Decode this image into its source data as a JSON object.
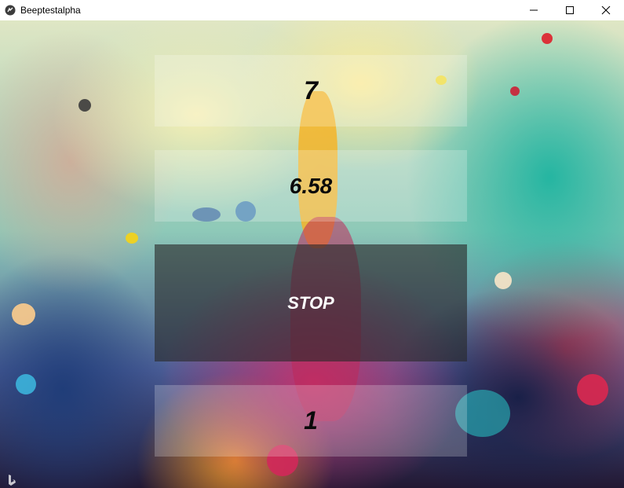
{
  "window": {
    "title": "Beeptestalpha",
    "icon": "kivy-logo-icon",
    "controls": [
      "minimize-icon",
      "maximize-icon",
      "close-icon"
    ]
  },
  "display": {
    "level": "7",
    "speed": "6.58",
    "button_label": "STOP",
    "shuttle": "1"
  },
  "colors": {
    "panel_light": "#ffffff",
    "panel_dark": "#282828",
    "text_dark": "#0a0a0a",
    "text_light": "#ffffff"
  },
  "watermark": {
    "icon": "bing-logo-icon"
  }
}
